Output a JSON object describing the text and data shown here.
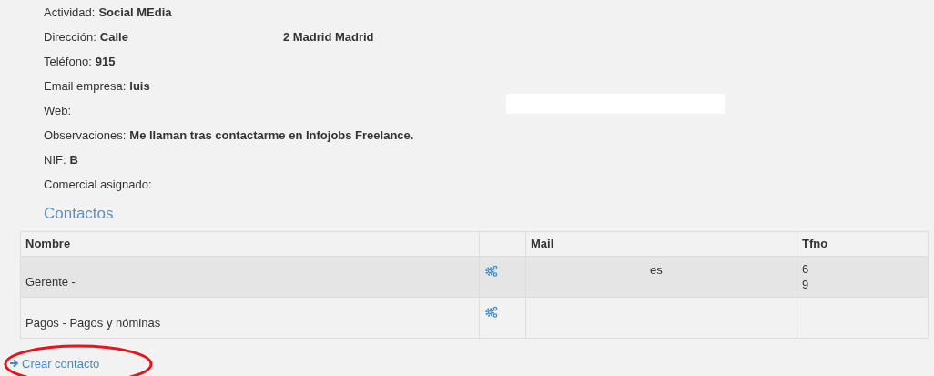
{
  "fields": [
    {
      "label": "Actividad:",
      "values": [
        "Social MEdia"
      ]
    },
    {
      "label": "Dirección:",
      "values": [
        "Calle",
        "2 Madrid Madrid"
      ]
    },
    {
      "label": "Teléfono:",
      "values": [
        "915"
      ]
    },
    {
      "label": "Email empresa:",
      "values": [
        "luis"
      ]
    },
    {
      "label": "Web:"
    },
    {
      "label": "Observaciones:",
      "values": [
        "Me llaman tras contactarme en Infojobs Freelance."
      ]
    },
    {
      "label": "NIF:",
      "values": [
        "B"
      ]
    },
    {
      "label": "Comercial asignado:"
    }
  ],
  "contacts": {
    "title": "Contactos",
    "columns": [
      "Nombre",
      "Mail",
      "Tfno"
    ],
    "rows": [
      {
        "name": "Gerente -",
        "mail": "es",
        "phones": [
          "6",
          "9"
        ],
        "highlighted": true
      },
      {
        "name": "Pagos - Pagos y nóminas",
        "mail": "",
        "phones": [],
        "highlighted": false
      }
    ]
  },
  "create_link": "Crear contacto"
}
